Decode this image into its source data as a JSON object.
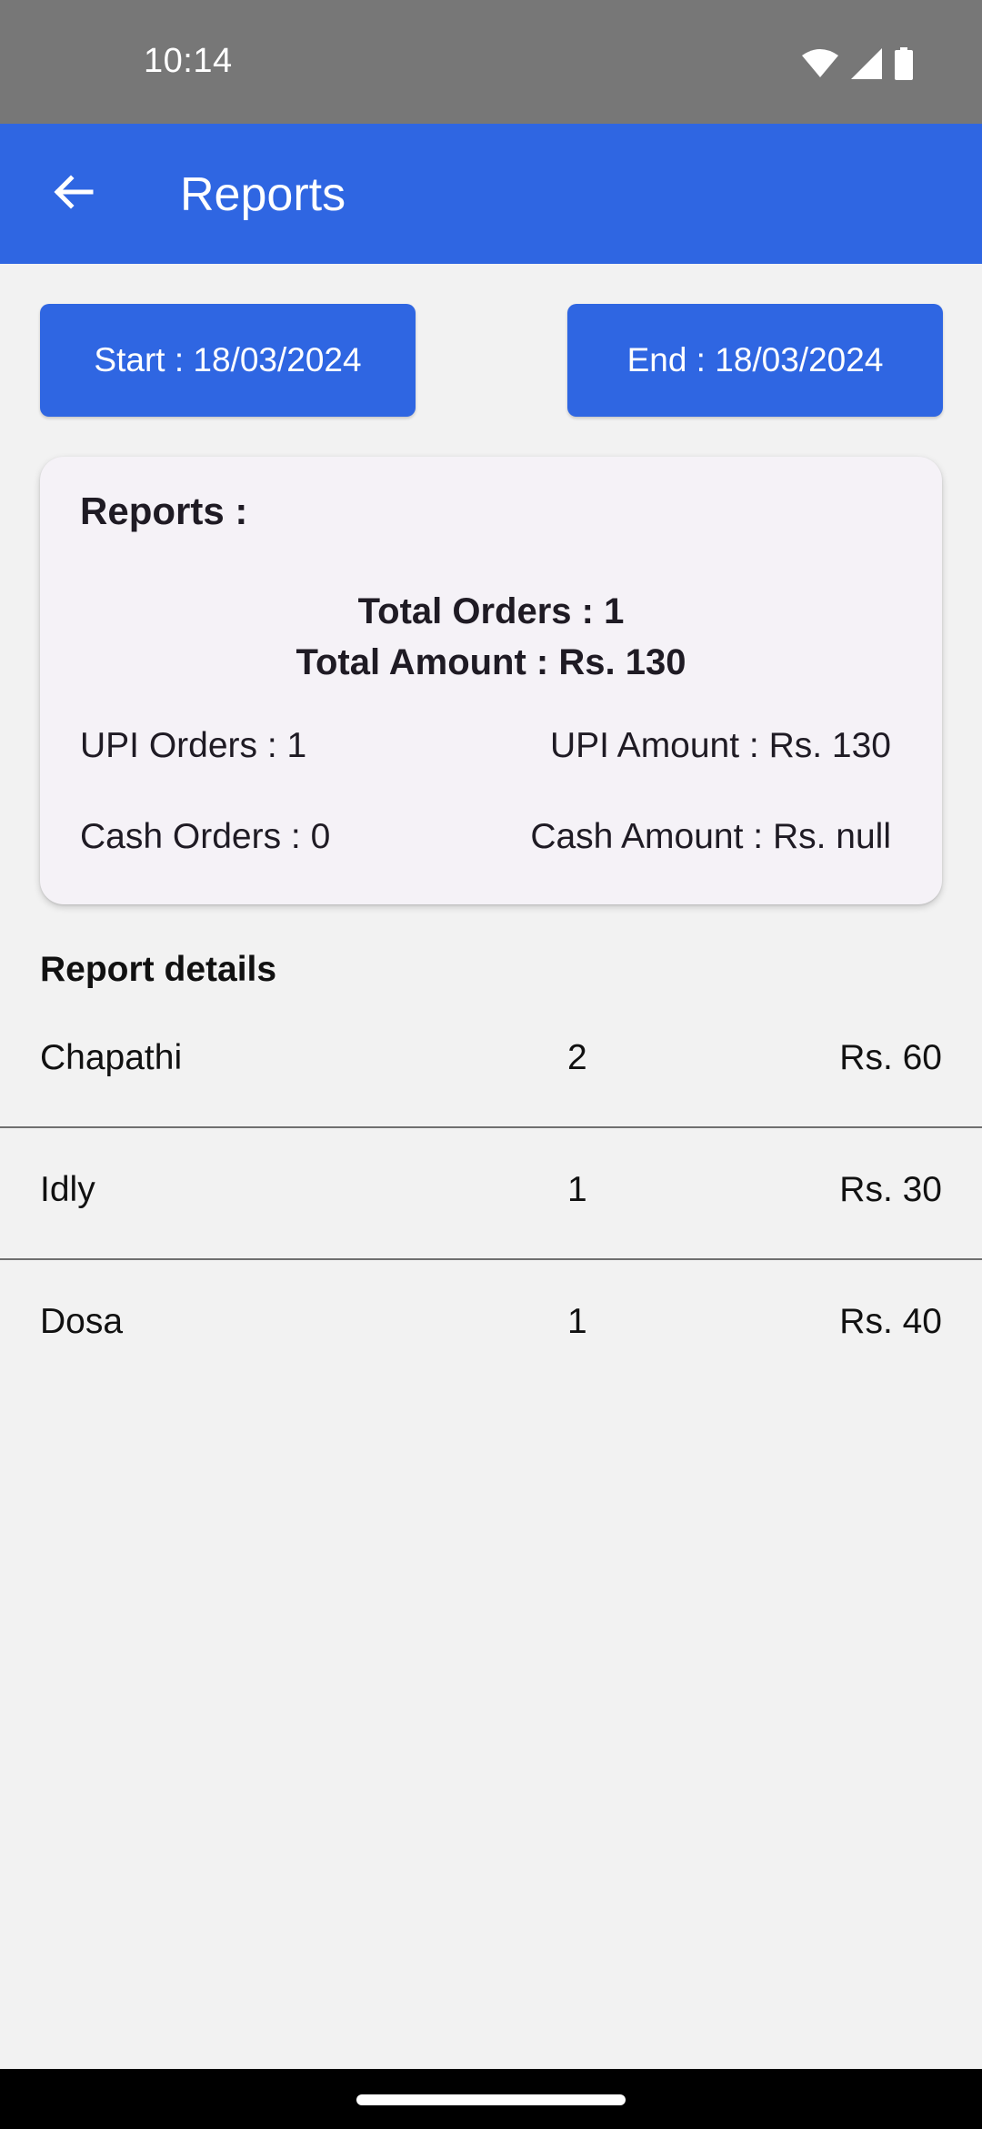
{
  "status_bar": {
    "time": "10:14",
    "icons": [
      "wifi-icon",
      "signal-icon",
      "battery-icon"
    ]
  },
  "app_bar": {
    "title": "Reports",
    "back_icon": "arrow-back-icon",
    "color": "#2f66e2"
  },
  "dates": {
    "start_label": "Start : 18/03/2024",
    "end_label": "End : 18/03/2024"
  },
  "summary": {
    "title": "Reports :",
    "total_orders": "Total Orders : 1",
    "total_amount": "Total Amount : Rs. 130",
    "upi_orders": "UPI Orders : 1",
    "upi_amount": "UPI Amount : Rs. 130",
    "cash_orders": "Cash Orders : 0",
    "cash_amount": "Cash Amount : Rs. null"
  },
  "details": {
    "title": "Report details",
    "items": [
      {
        "name": "Chapathi",
        "qty": "2",
        "amount": "Rs. 60"
      },
      {
        "name": "Idly",
        "qty": "1",
        "amount": "Rs. 30"
      },
      {
        "name": "Dosa",
        "qty": "1",
        "amount": "Rs. 40"
      }
    ]
  }
}
